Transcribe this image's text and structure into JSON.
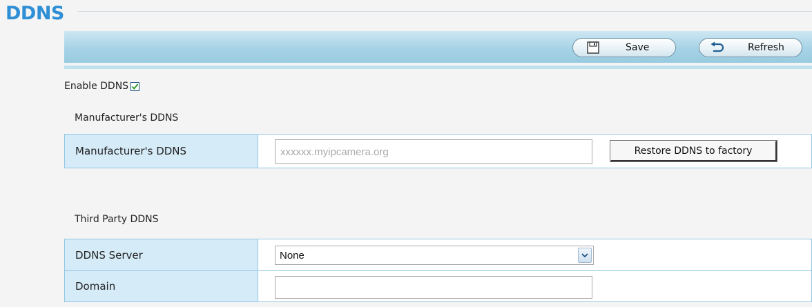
{
  "page": {
    "title": "DDNS"
  },
  "toolbar": {
    "save_label": "Save",
    "refresh_label": "Refresh",
    "save_icon": "floppy-disk-icon",
    "refresh_icon": "refresh-arrow-icon"
  },
  "enable": {
    "label": "Enable DDNS",
    "checked": true
  },
  "manufacturer": {
    "section_title": "Manufacturer's DDNS",
    "field_label": "Manufacturer's DDNS",
    "placeholder": "xxxxxx.myipcamera.org",
    "value": "",
    "restore_label": "Restore DDNS to factory"
  },
  "third_party": {
    "section_title": "Third Party DDNS",
    "server_label": "DDNS Server",
    "server_selected": "None",
    "domain_label": "Domain",
    "domain_value": ""
  },
  "colors": {
    "title": "#2f8fd6",
    "toolbar": "#a7d3e6",
    "label_cell": "#d5ebf7",
    "cell_border": "#8fc6e5",
    "check": "#2e9a2e"
  }
}
